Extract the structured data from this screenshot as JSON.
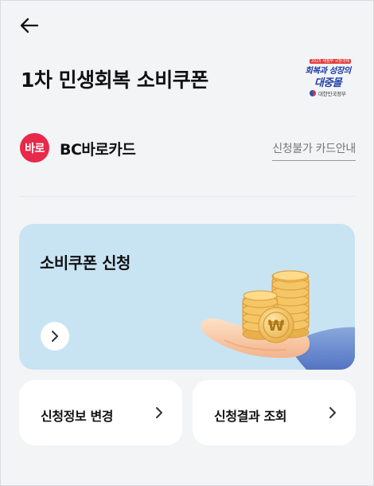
{
  "header": {
    "back_icon": "arrow-left-icon",
    "title": "1차 민생회복 소비쿠폰"
  },
  "emblem": {
    "top_text": "2025 새정부 국정과제",
    "line1": "회복과 성장의",
    "line2": "대중몰",
    "gov_text": "대한민국정부"
  },
  "card": {
    "logo_text": "바로",
    "name": "BC바로카드",
    "unavailable_link": "신청불가 카드안내",
    "brand_color": "#e8294a"
  },
  "banner": {
    "title": "소비쿠폰 신청",
    "arrow_icon": "chevron-right-icon",
    "illustration": "hand-holding-coins",
    "coin_symbol": "₩",
    "background": "#c8e4f3"
  },
  "actions": [
    {
      "label": "신청정보 변경",
      "icon": "chevron-right-icon"
    },
    {
      "label": "신청결과 조회",
      "icon": "chevron-right-icon"
    }
  ]
}
